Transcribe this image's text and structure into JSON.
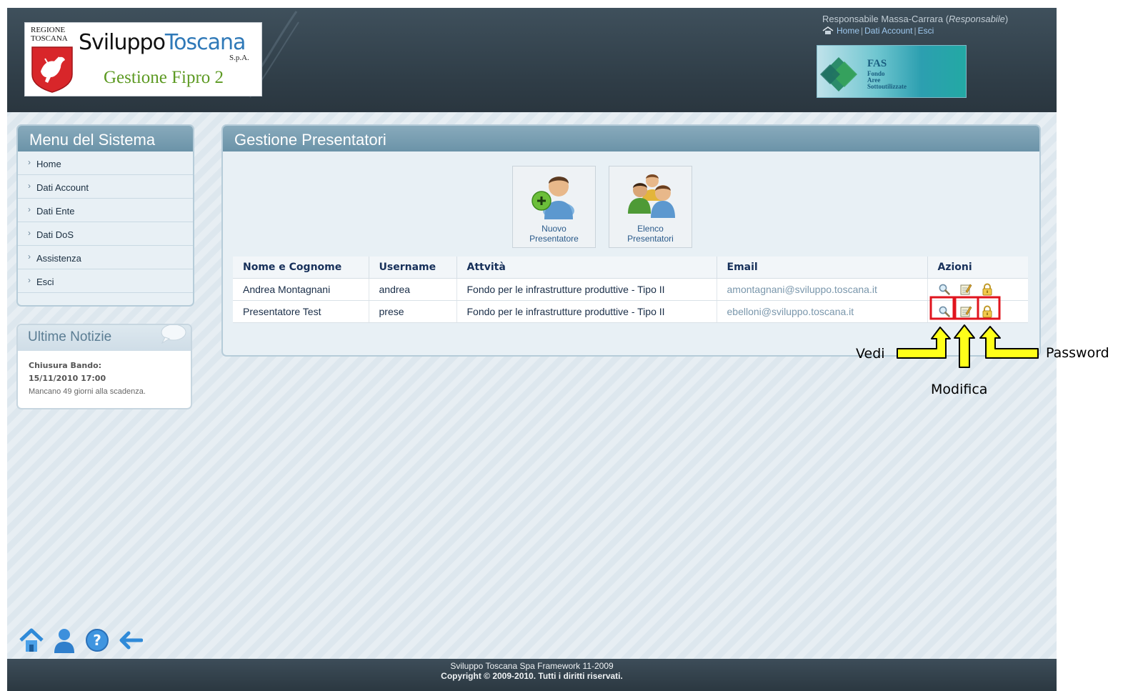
{
  "header": {
    "logo": {
      "region_text": "REGIONE TOSCANA",
      "brand_part1": "Sviluppo",
      "brand_part2": "Toscana",
      "brand_suffix": "S.p.A.",
      "app_name": "Gestione Fipro 2"
    },
    "user": {
      "name": "Responsabile Massa-Carrara",
      "role": "Responsabile",
      "links": [
        "Home",
        "Dati Account",
        "Esci"
      ]
    },
    "banner": {
      "title": "FAS",
      "subtitle": [
        "Fondo",
        "Aree",
        "Sottoutilizzate"
      ]
    }
  },
  "sidebar": {
    "menu_title": "Menu del Sistema",
    "menu_items": [
      "Home",
      "Dati Account",
      "Dati Ente",
      "Dati DoS",
      "Assistenza",
      "Esci"
    ],
    "news": {
      "title": "Ultime Notizie",
      "item_title": "Chiusura Bando:",
      "item_date": "15/11/2010 17:00",
      "item_text": "Mancano 49 giorni alla scadenza."
    }
  },
  "main": {
    "title": "Gestione Presentatori",
    "toolbar": {
      "nuovo": [
        "Nuovo",
        "Presentatore"
      ],
      "elenco": [
        "Elenco",
        "Presentatori"
      ]
    },
    "table": {
      "headers": [
        "Nome e Cognome",
        "Username",
        "Attvità",
        "Email",
        "Azioni"
      ],
      "rows": [
        {
          "name": "Andrea Montagnani",
          "username": "andrea",
          "attivita": "Fondo per le infrastrutture produttive - Tipo II",
          "email": "amontagnani@sviluppo.toscana.it"
        },
        {
          "name": "Presentatore Test",
          "username": "prese",
          "attivita": "Fondo per le infrastrutture produttive - Tipo II",
          "email": "ebelloni@sviluppo.toscana.it"
        }
      ],
      "action_icons": [
        "magnifier-icon",
        "edit-icon",
        "padlock-icon"
      ]
    }
  },
  "bottom_icons": [
    "home-icon",
    "user-icon",
    "help-icon",
    "back-arrow-icon"
  ],
  "footer": {
    "line1": "Sviluppo Toscana Spa Framework 11-2009",
    "line2": "Copyright © 2009-2010. Tutti i diritti riservati."
  },
  "annotations": {
    "vedi": "Vedi",
    "modifica": "Modifica",
    "password": "Password",
    "highlight_color": "#e0141e",
    "arrow_color": "#ffff1a"
  }
}
